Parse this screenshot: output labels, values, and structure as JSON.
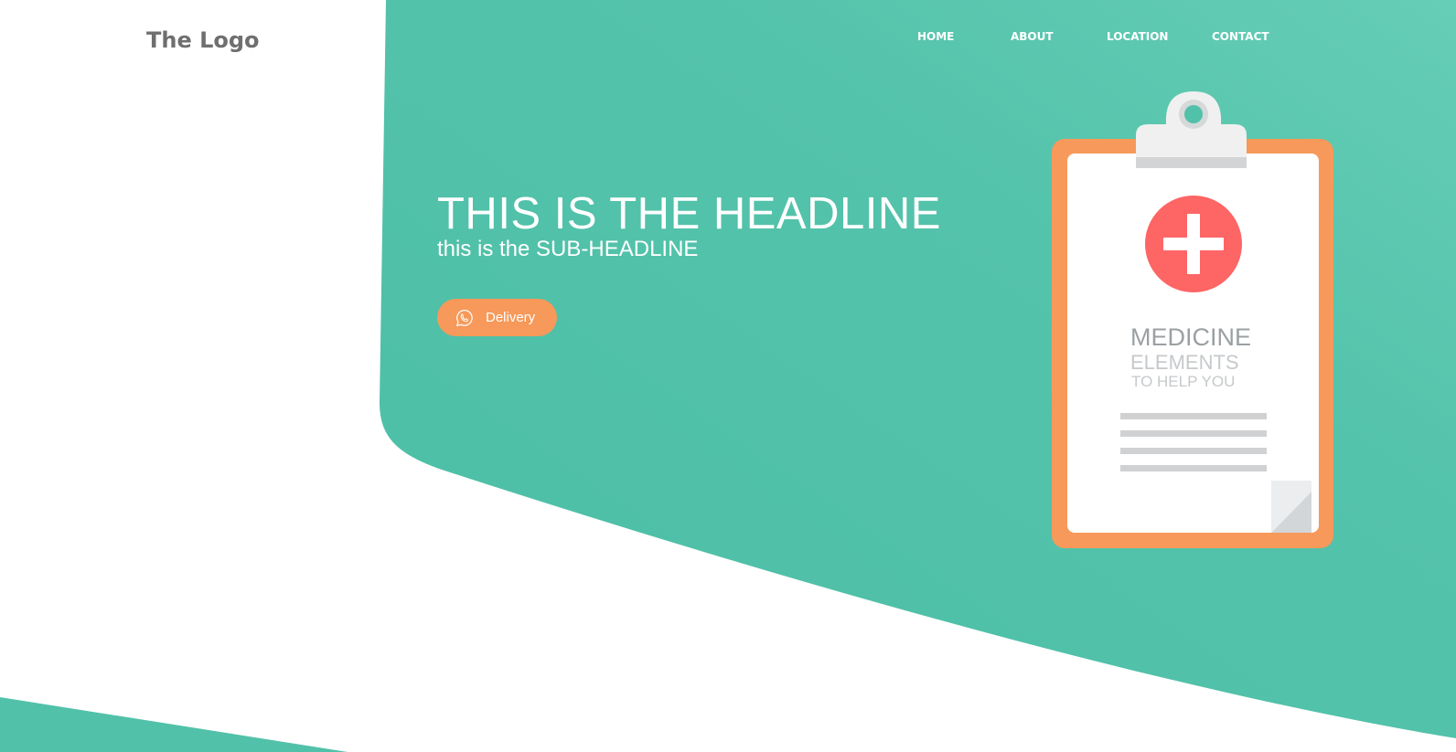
{
  "brand": {
    "logo_text": "The Logo"
  },
  "nav": {
    "items": [
      {
        "label": "HOME"
      },
      {
        "label": "ABOUT"
      },
      {
        "label": "LOCATION"
      },
      {
        "label": "CONTACT"
      }
    ]
  },
  "hero": {
    "headline": "THIS IS THE HEADLINE",
    "subheadline": "this is the SUB-HEADLINE",
    "cta": {
      "label": "Delivery",
      "icon": "whatsapp-icon"
    }
  },
  "illustration": {
    "line1": "MEDICINE",
    "line2": "ELEMENTS",
    "line3": "TO HELP YOU",
    "icon": "medical-cross-icon"
  },
  "colors": {
    "teal": "#52c1a9",
    "accent_orange": "#f6995a",
    "cross_red": "#fe6565",
    "logo_gray": "#6f6f6f",
    "white": "#ffffff"
  }
}
